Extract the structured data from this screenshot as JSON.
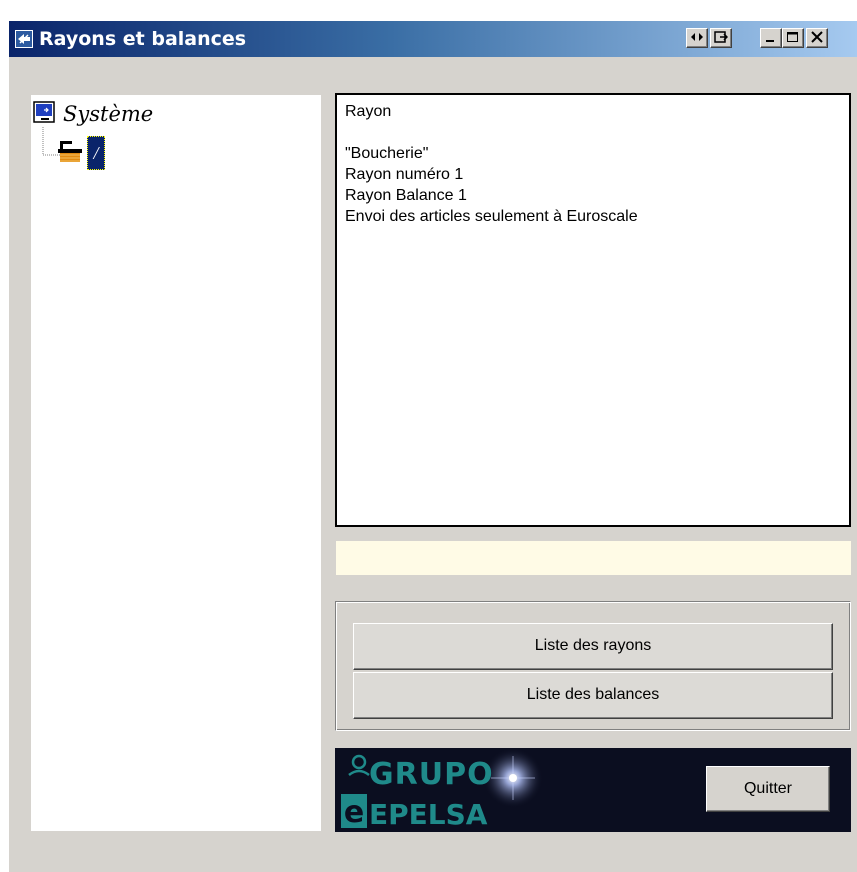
{
  "window": {
    "title": "Rayons et balances",
    "title_icon": "app-icon",
    "controls": {
      "float": "↔",
      "dock": "dock-icon",
      "minimize": "_",
      "maximize": "□",
      "close": "X"
    }
  },
  "tree": {
    "root": {
      "label": "Système",
      "icon": "computer-icon"
    },
    "child": {
      "label": "/",
      "icon": "scale-icon"
    }
  },
  "info": {
    "lines": [
      "Rayon",
      "",
      "\"Boucherie\"",
      "Rayon numéro 1",
      "Rayon Balance 1",
      "Envoi des articles seulement à Euroscale"
    ]
  },
  "status": {
    "text": ""
  },
  "actions": {
    "list_departments": "Liste des rayons",
    "list_scales": "Liste des balances"
  },
  "logo": {
    "line1": "GRUPO",
    "line2": "EPELSA",
    "letter": "e"
  },
  "footer": {
    "quit_label": "Quitter"
  },
  "colors": {
    "titlebar_start": "#0a246a",
    "titlebar_end": "#a6caf0",
    "window_bg": "#d6d3ce",
    "status_bg": "#fffbe6",
    "logo_bg": "#0b0e20",
    "logo_text": "#1f8a8a"
  }
}
